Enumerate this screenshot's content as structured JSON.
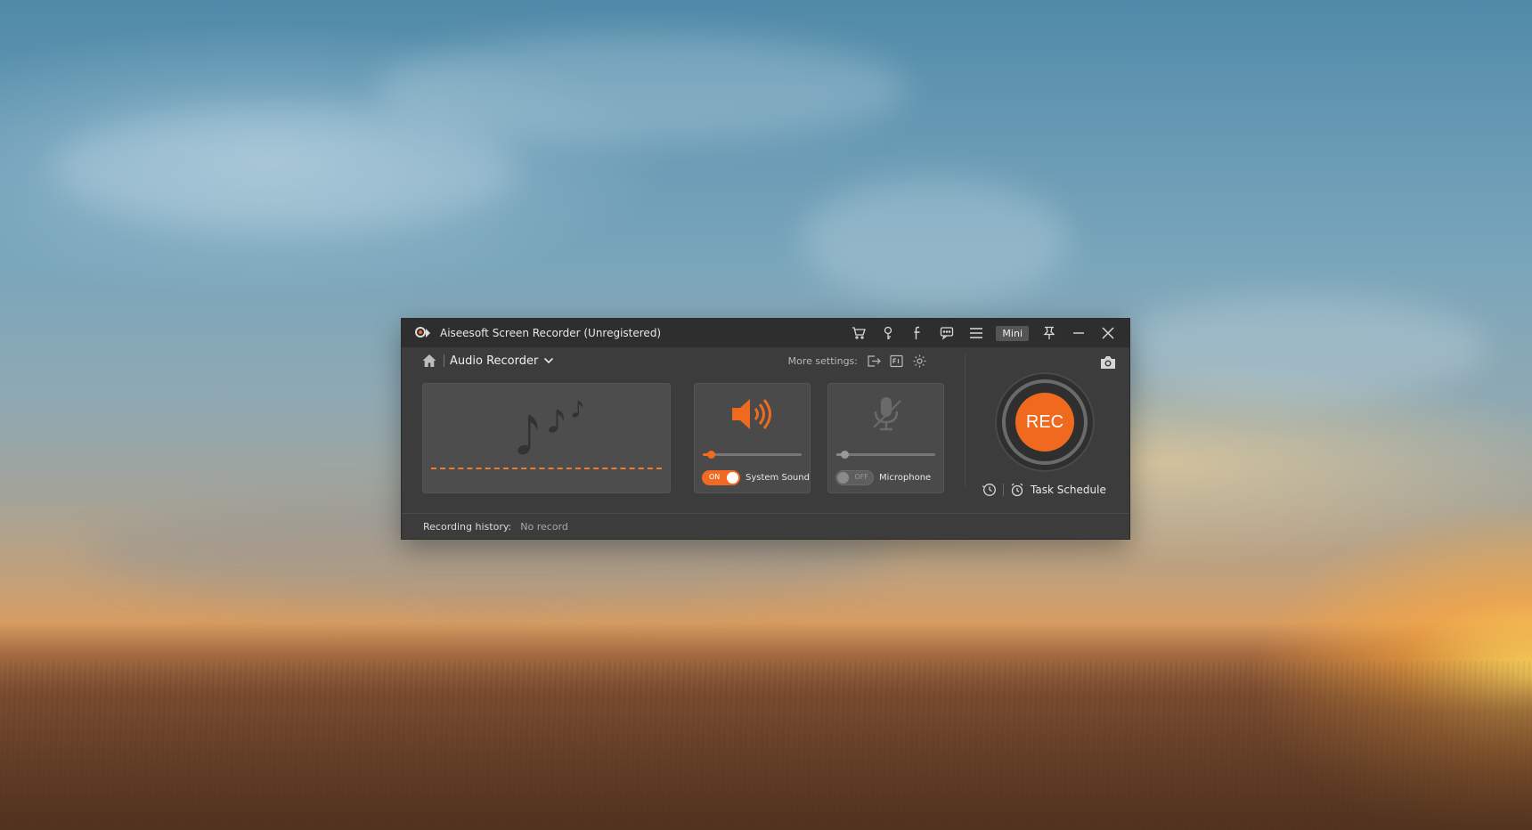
{
  "window": {
    "title": "Aiseesoft Screen Recorder (Unregistered)",
    "mini_label": "Mini"
  },
  "toolbar": {
    "mode_label": "Audio Recorder",
    "more_settings_label": "More settings:"
  },
  "system_sound": {
    "label": "System Sound",
    "toggle_text": "ON",
    "volume_level": 0.08
  },
  "microphone": {
    "label": "Microphone",
    "toggle_text": "OFF",
    "volume_level": 0.08
  },
  "record": {
    "button_label": "REC",
    "task_schedule_label": "Task Schedule"
  },
  "footer": {
    "history_label": "Recording history:",
    "history_value": "No record"
  },
  "colors": {
    "accent": "#ef6a1f",
    "window_bg": "#3c3c3c",
    "titlebar_bg": "#2e2e2e"
  },
  "icons": [
    "app-logo-icon",
    "cart-icon",
    "key-icon",
    "facebook-icon",
    "feedback-icon",
    "menu-icon",
    "pin-icon",
    "minimize-icon",
    "close-icon",
    "home-icon",
    "chevron-down-icon",
    "export-icon",
    "format-icon",
    "gear-icon",
    "music-notes-icon",
    "speaker-icon",
    "microphone-icon",
    "camera-icon",
    "clock-icon",
    "alarm-clock-icon"
  ]
}
